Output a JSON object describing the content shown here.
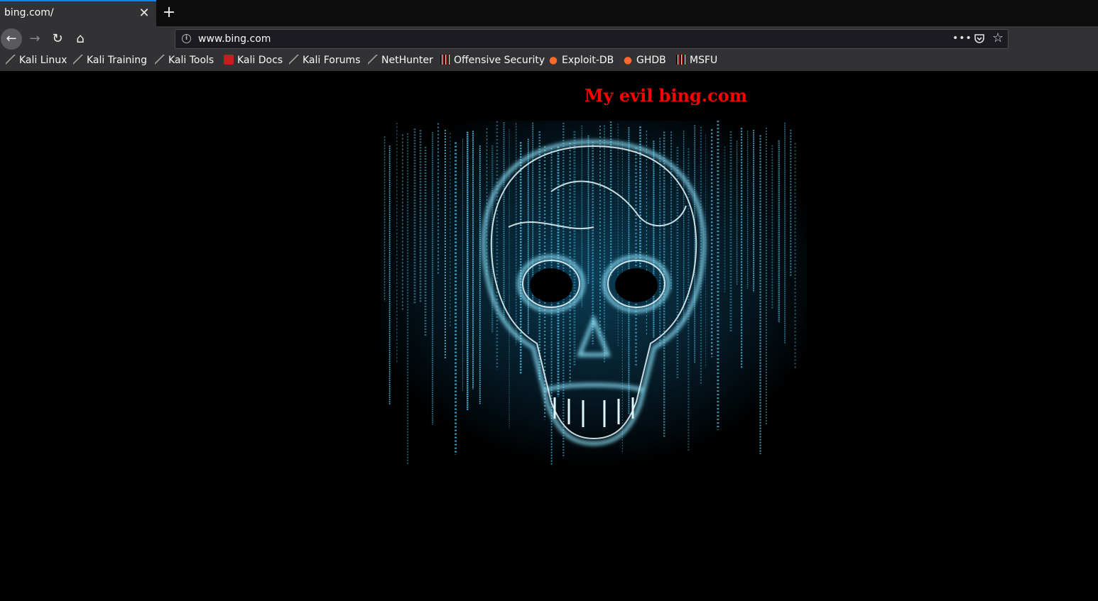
{
  "tab": {
    "title": "bing.com/",
    "close": "✕"
  },
  "new_tab": "+",
  "nav": {
    "back": "←",
    "forward": "→",
    "reload": "↻",
    "home": "⌂"
  },
  "url": {
    "value": "www.bing.com",
    "info_icon": "info-icon",
    "page_actions": "•••",
    "pocket": "pocket-icon",
    "bookmark": "☆"
  },
  "bookmarks": [
    {
      "label": "Kali Linux",
      "icon": "kali-dragon-icon"
    },
    {
      "label": "Kali Training",
      "icon": "kali-dragon-icon"
    },
    {
      "label": "Kali Tools",
      "icon": "kali-dragon-icon"
    },
    {
      "label": "Kali Docs",
      "icon": "kali-docs-icon"
    },
    {
      "label": "Kali Forums",
      "icon": "kali-dragon-icon"
    },
    {
      "label": "NetHunter",
      "icon": "kali-dragon-icon"
    },
    {
      "label": "Offensive Security",
      "icon": "offsec-icon"
    },
    {
      "label": "Exploit-DB",
      "icon": "exploit-db-icon"
    },
    {
      "label": "GHDB",
      "icon": "exploit-db-icon"
    },
    {
      "label": "MSFU",
      "icon": "offsec-icon"
    }
  ],
  "page": {
    "heading": "My evil bing.com",
    "image": "glowing-skull-matrix-image"
  },
  "colors": {
    "heading": "#ff0000",
    "accent": "#0a84ff",
    "glow": "#5fd8ff"
  }
}
